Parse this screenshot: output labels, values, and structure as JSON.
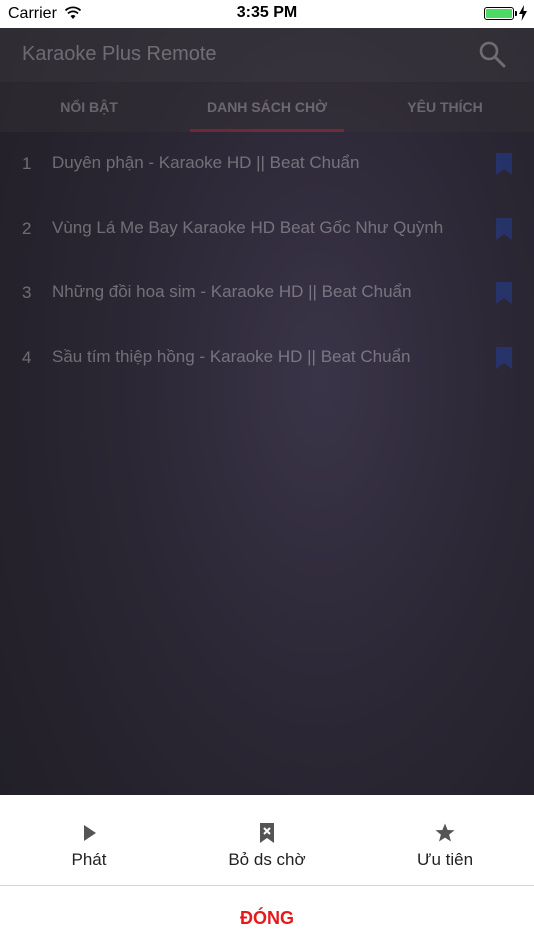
{
  "status_bar": {
    "carrier": "Carrier",
    "time": "3:35 PM"
  },
  "header": {
    "title": "Karaoke Plus Remote"
  },
  "tabs": [
    {
      "label": "NỔI BẬT",
      "active": false
    },
    {
      "label": "DANH SÁCH CHỜ",
      "active": true
    },
    {
      "label": "YÊU THÍCH",
      "active": false
    }
  ],
  "queue": [
    {
      "num": "1",
      "title": "Duyên phận - Karaoke HD || Beat Chuẩn"
    },
    {
      "num": "2",
      "title": "Vùng Lá Me Bay   Karaoke HD   Beat Gốc Như Quỳnh"
    },
    {
      "num": "3",
      "title": "Những đồi hoa sim - Karaoke HD || Beat Chuẩn"
    },
    {
      "num": "4",
      "title": "Sầu tím thiệp hồng - Karaoke HD || Beat Chuẩn"
    }
  ],
  "sheet": {
    "actions": [
      {
        "label": "Phát",
        "icon": "play-icon"
      },
      {
        "label": "Bỏ ds chờ",
        "icon": "remove-bookmark-icon"
      },
      {
        "label": "Ưu tiên",
        "icon": "star-icon"
      }
    ],
    "close_label": "ĐÓNG"
  },
  "colors": {
    "accent": "#e8191a",
    "bookmark": "#1e4fd8",
    "battery": "#4cd964"
  }
}
